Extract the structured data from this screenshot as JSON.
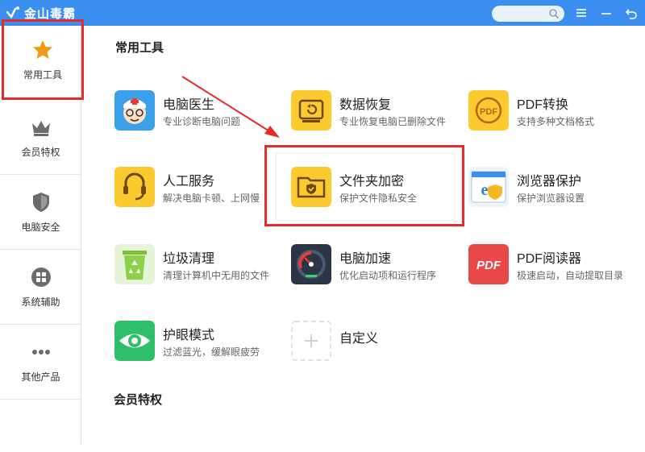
{
  "app": {
    "title": "金山毒霸",
    "accent": "#3a8ff0",
    "highlight": "#e52b2b"
  },
  "titlebar": {
    "search_placeholder": "",
    "icons": [
      "search-icon",
      "menu-icon",
      "minimize-icon",
      "back-icon"
    ]
  },
  "sidebar": {
    "items": [
      {
        "label": "常用工具",
        "icon": "star-icon",
        "active": true
      },
      {
        "label": "会员特权",
        "icon": "crown-icon",
        "active": false
      },
      {
        "label": "电脑安全",
        "icon": "shield-icon",
        "active": false
      },
      {
        "label": "系统辅助",
        "icon": "windows-icon",
        "active": false
      },
      {
        "label": "其他产品",
        "icon": "more-icon",
        "active": false
      }
    ]
  },
  "main": {
    "section1": "常用工具",
    "section2": "会员特权",
    "tools": [
      {
        "name": "电脑医生",
        "desc": "专业诊断电脑问题",
        "icon": "doctor-icon"
      },
      {
        "name": "数据恢复",
        "desc": "专业恢复电脑已删除文件",
        "icon": "data-recovery-icon"
      },
      {
        "name": "PDF转换",
        "desc": "支持多种文档格式",
        "icon": "pdf-convert-icon"
      },
      {
        "name": "人工服务",
        "desc": "解决电脑卡顿、上网慢",
        "icon": "headset-icon"
      },
      {
        "name": "文件夹加密",
        "desc": "保护文件隐私安全",
        "icon": "folder-lock-icon"
      },
      {
        "name": "浏览器保护",
        "desc": "保护浏览器设置",
        "icon": "browser-shield-icon"
      },
      {
        "name": "垃圾清理",
        "desc": "清理计算机中无用的文件",
        "icon": "recycle-bin-icon"
      },
      {
        "name": "电脑加速",
        "desc": "优化启动项和运行程序",
        "icon": "speedometer-icon"
      },
      {
        "name": "PDF阅读器",
        "desc": "极速启动，自动提取目录",
        "icon": "pdf-reader-icon"
      },
      {
        "name": "护眼模式",
        "desc": "过滤蓝光，缓解眼疲劳",
        "icon": "eye-icon"
      },
      {
        "name": "自定义",
        "desc": "",
        "icon": "plus-icon"
      }
    ]
  }
}
